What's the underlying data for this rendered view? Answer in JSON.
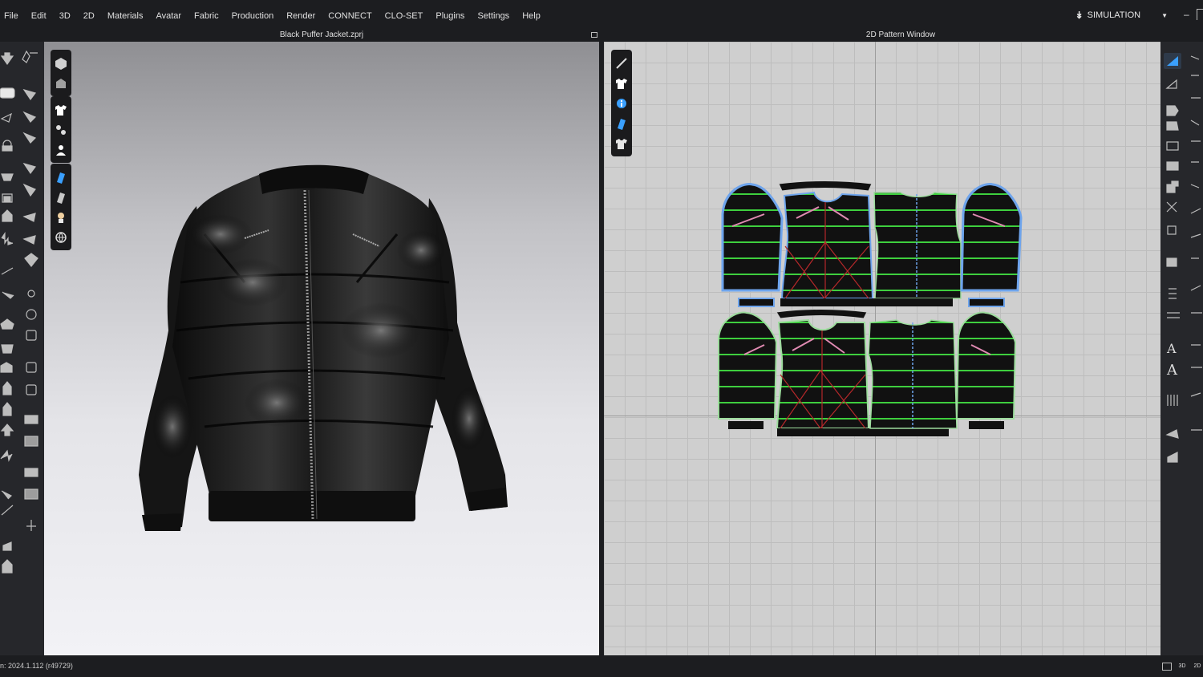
{
  "menu": [
    "File",
    "Edit",
    "3D",
    "2D",
    "Materials",
    "Avatar",
    "Fabric",
    "Production",
    "Render",
    "CONNECT",
    "CLO-SET",
    "Plugins",
    "Settings",
    "Help"
  ],
  "mode": {
    "label": "SIMULATION"
  },
  "viewport3d": {
    "title": "Black Puffer Jacket.zprj"
  },
  "viewport2d": {
    "title": "2D Pattern Window"
  },
  "status": {
    "version_text": "n: 2024.1.112 (r49729)"
  },
  "view_buttons": {
    "split": "",
    "mode3d": "3D",
    "mode2d": "2D"
  },
  "colors": {
    "accent": "#3aa0ff",
    "seam_green": "#3ecf3e",
    "pattern_fill": "#111111",
    "outline_blue": "#6ea4ec",
    "internal_red": "#b5282a",
    "internal_pink": "#e08ab2"
  },
  "icons": {
    "left_toolbar": "garment-tool-icons",
    "viewport_toolbar": "display-toggle-icons",
    "right_toolbar": "pattern-tool-icons"
  }
}
